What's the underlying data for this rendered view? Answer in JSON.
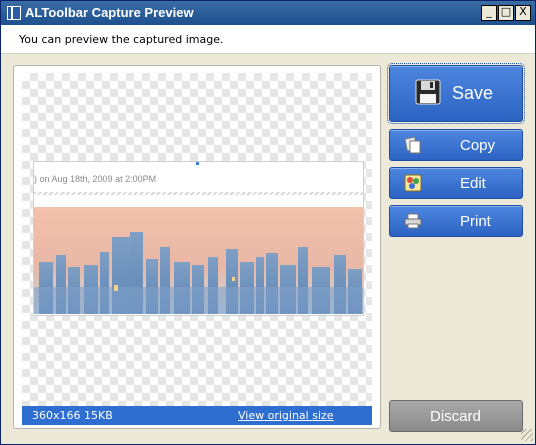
{
  "window": {
    "title": "ALToolbar Capture Preview",
    "controls": {
      "minimize": "_",
      "maximize": "□",
      "close": "X"
    }
  },
  "header": {
    "instruction": "You can preview the captured image."
  },
  "preview": {
    "caption_text": ") on Aug 18th, 2009 at 2:00PM",
    "status": {
      "size_info": "360x166  15KB",
      "link_label": "View original size"
    }
  },
  "actions": {
    "save": {
      "label": "Save",
      "icon": "floppy-disk-icon"
    },
    "copy": {
      "label": "Copy",
      "icon": "copy-icon"
    },
    "edit": {
      "label": "Edit",
      "icon": "edit-icon"
    },
    "print": {
      "label": "Print",
      "icon": "printer-icon"
    },
    "discard": {
      "label": "Discard"
    }
  },
  "colors": {
    "title_bar": "#1e4f8f",
    "button_blue": "#2c63c3",
    "discard_gray": "#8a8a8a",
    "status_bar": "#2f6ed1"
  }
}
